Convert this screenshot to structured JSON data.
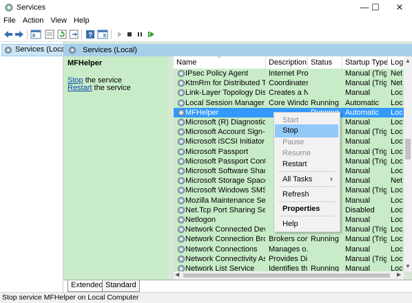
{
  "window": {
    "title": "Services",
    "minimize": "—",
    "maximize": "☐",
    "close": "✕"
  },
  "menu": [
    "File",
    "Action",
    "View",
    "Help"
  ],
  "tree": {
    "root_label": "Services (Local)"
  },
  "pane": {
    "header": "Services (Local)"
  },
  "description": {
    "service_name": "MFHelper",
    "stop_link": "Stop",
    "stop_suffix": " the service",
    "restart_link": "Restart",
    "restart_suffix": " the service"
  },
  "columns": [
    "Name",
    "Description",
    "Status",
    "Startup Type",
    "Log"
  ],
  "services": [
    {
      "name": "IPsec Policy Agent",
      "description": "Internet Pro...",
      "status": "",
      "startup": "Manual (Trig...",
      "logon": "Net"
    },
    {
      "name": "KtmRm for Distributed Tran...",
      "description": "Coordinates...",
      "status": "",
      "startup": "Manual (Trig...",
      "logon": "Net"
    },
    {
      "name": "Link-Layer Topology Discov...",
      "description": "Creates a N...",
      "status": "",
      "startup": "Manual",
      "logon": "Loc"
    },
    {
      "name": "Local Session Manager",
      "description": "Core Windo...",
      "status": "Running",
      "startup": "Automatic",
      "logon": "Loc"
    },
    {
      "name": "MFHelper",
      "description": "",
      "status": "Running",
      "startup": "Automatic",
      "logon": "Loc",
      "selected": true
    },
    {
      "name": "Microsoft (R) Diagnostics H...",
      "description": "",
      "status": "",
      "startup": "Manual",
      "logon": "Loc"
    },
    {
      "name": "Microsoft Account Sign-in ...",
      "description": "",
      "status": "",
      "startup": "Manual (Trig...",
      "logon": "Loc"
    },
    {
      "name": "Microsoft iSCSI Initiator Ser...",
      "description": "",
      "status": "",
      "startup": "Manual",
      "logon": "Loc"
    },
    {
      "name": "Microsoft Passport",
      "description": "",
      "status": "",
      "startup": "Manual (Trig...",
      "logon": "Loc"
    },
    {
      "name": "Microsoft Passport Container",
      "description": "",
      "status": "",
      "startup": "Manual (Trig...",
      "logon": "Loc"
    },
    {
      "name": "Microsoft Software Shadow...",
      "description": "",
      "status": "",
      "startup": "Manual",
      "logon": "Loc"
    },
    {
      "name": "Microsoft Storage Spaces S...",
      "description": "",
      "status": "",
      "startup": "Manual",
      "logon": "Net"
    },
    {
      "name": "Microsoft Windows SMS Ro...",
      "description": "",
      "status": "",
      "startup": "Manual (Trig...",
      "logon": "Loc"
    },
    {
      "name": "Mozilla Maintenance Service",
      "description": "",
      "status": "",
      "startup": "Manual",
      "logon": "Loc"
    },
    {
      "name": "Net.Tcp Port Sharing Service",
      "description": "",
      "status": "",
      "startup": "Disabled",
      "logon": "Loc"
    },
    {
      "name": "Netlogon",
      "description": "",
      "status": "",
      "startup": "Manual",
      "logon": "Loc"
    },
    {
      "name": "Network Connected Device...",
      "description": "",
      "status": "",
      "startup": "Manual (Trig...",
      "logon": "Loc"
    },
    {
      "name": "Network Connection Broker",
      "description": "Brokers con...",
      "status": "Running",
      "startup": "Manual (Trig...",
      "logon": "Loc"
    },
    {
      "name": "Network Connections",
      "description": "Manages o...",
      "status": "",
      "startup": "Manual",
      "logon": "Loc"
    },
    {
      "name": "Network Connectivity Assis...",
      "description": "Provides Dir...",
      "status": "",
      "startup": "Manual (Trig...",
      "logon": "Loc"
    },
    {
      "name": "Network List Service",
      "description": "Identifies th...",
      "status": "Running",
      "startup": "Manual",
      "logon": "Loc"
    }
  ],
  "context_menu": {
    "start": "Start",
    "stop": "Stop",
    "pause": "Pause",
    "resume": "Resume",
    "restart": "Restart",
    "all_tasks": "All Tasks",
    "all_tasks_arrow": "›",
    "refresh": "Refresh",
    "properties": "Properties",
    "help": "Help"
  },
  "tabs": {
    "extended": "Extended",
    "standard": "Standard"
  },
  "status_bar": "Stop service MFHelper on Local Computer",
  "colors": {
    "selection": "#3399ff",
    "pane_green": "#c8ecc8",
    "header_blue": "#a8cfe8",
    "menu_highlight": "#91c9f7",
    "link": "#0645ad"
  },
  "icons": {
    "app": "gear-icon",
    "service": "gear-icon",
    "toolbar": [
      "back-arrow-icon",
      "forward-arrow-icon",
      "show-hide-console-tree-icon",
      "properties-icon",
      "refresh-icon",
      "export-list-icon",
      "help-icon",
      "show-hide-action-pane-icon",
      "play-icon",
      "stop-icon",
      "pause-icon",
      "restart-icon"
    ]
  }
}
